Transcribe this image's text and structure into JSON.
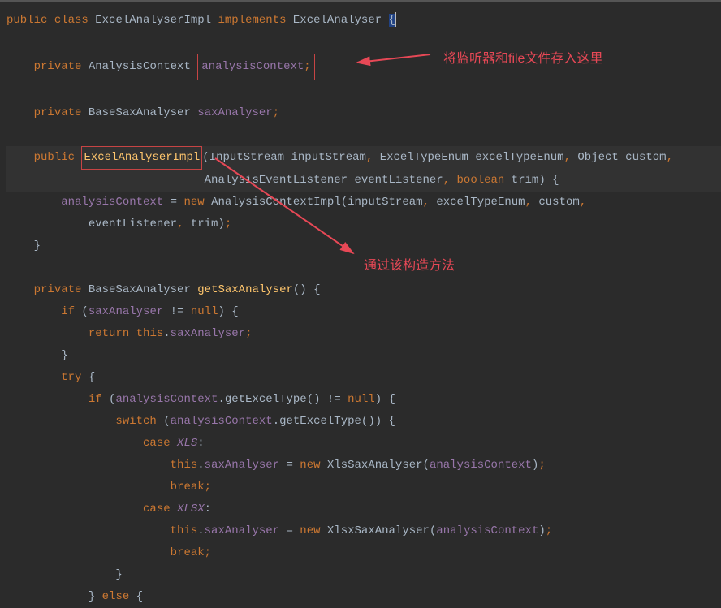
{
  "code": {
    "line1_public": "public",
    "line1_class": "class",
    "line1_classname": "ExcelAnalyserImpl",
    "line1_implements": "implements",
    "line1_interface": "ExcelAnalyser ",
    "line1_brace": "{",
    "line3_private": "private",
    "line3_type": "AnalysisContext",
    "line3_field": "analysisContext",
    "line3_semi": ";",
    "line5_private": "private",
    "line5_type": "BaseSaxAnalyser",
    "line5_field": "saxAnalyser",
    "line5_semi": ";",
    "line7_public": "public",
    "line7_method": "ExcelAnalyserImpl",
    "line7_params": "(InputStream inputStream",
    "line7_comma1": ",",
    "line7_param2": " ExcelTypeEnum excelTypeEnum",
    "line7_comma2": ",",
    "line7_param3": " Object custom",
    "line7_comma3": ",",
    "line8_param4": "AnalysisEventListener eventListener",
    "line8_comma4": ",",
    "line8_boolean": "boolean",
    "line8_param5": " trim) {",
    "line9_field": "analysisContext",
    "line9_eq": " = ",
    "line9_new": "new",
    "line9_ctor": " AnalysisContextImpl(inputStream",
    "line9_comma1": ",",
    "line9_p2": " excelTypeEnum",
    "line9_comma2": ",",
    "line9_p3": " custom",
    "line9_comma3": ",",
    "line10_p4": "eventListener",
    "line10_comma": ",",
    "line10_p5": " trim)",
    "line10_semi": ";",
    "line11_brace": "}",
    "line13_private": "private",
    "line13_type": "BaseSaxAnalyser",
    "line13_method": "getSaxAnalyser",
    "line13_parens": "() {",
    "line14_if": "if",
    "line14_cond_open": " (",
    "line14_field": "saxAnalyser",
    "line14_cond": " != ",
    "line14_null": "null",
    "line14_cond_close": ") {",
    "line15_return": "return",
    "line15_this": "this",
    "line15_dot": ".",
    "line15_field": "saxAnalyser",
    "line15_semi": ";",
    "line16_brace": "}",
    "line17_try": "try",
    "line17_brace": " {",
    "line18_if": "if",
    "line18_open": " (",
    "line18_field": "analysisContext",
    "line18_dot": ".",
    "line18_method": "getExcelType",
    "line18_call": "() != ",
    "line18_null": "null",
    "line18_close": ") {",
    "line19_switch": "switch",
    "line19_open": " (",
    "line19_field": "analysisContext",
    "line19_dot": ".",
    "line19_method": "getExcelType",
    "line19_call": "()) {",
    "line20_case": "case",
    "line20_const": "XLS",
    "line20_colon": ":",
    "line21_this": "this",
    "line21_dot": ".",
    "line21_field": "saxAnalyser",
    "line21_eq": " = ",
    "line21_new": "new",
    "line21_ctor": " XlsSaxAnalyser(",
    "line21_arg": "analysisContext",
    "line21_close": ")",
    "line21_semi": ";",
    "line22_break": "break",
    "line22_semi": ";",
    "line23_case": "case",
    "line23_const": "XLSX",
    "line23_colon": ":",
    "line24_this": "this",
    "line24_dot": ".",
    "line24_field": "saxAnalyser",
    "line24_eq": " = ",
    "line24_new": "new",
    "line24_ctor": " XlsxSaxAnalyser(",
    "line24_arg": "analysisContext",
    "line24_close": ")",
    "line24_semi": ";",
    "line25_break": "break",
    "line25_semi": ";",
    "line26_brace": "}",
    "line27_brace": "} ",
    "line27_else": "else",
    "line27_brace2": " {"
  },
  "annotations": {
    "top": "将监听器和file文件存入这里",
    "bottom": "通过该构造方法"
  }
}
